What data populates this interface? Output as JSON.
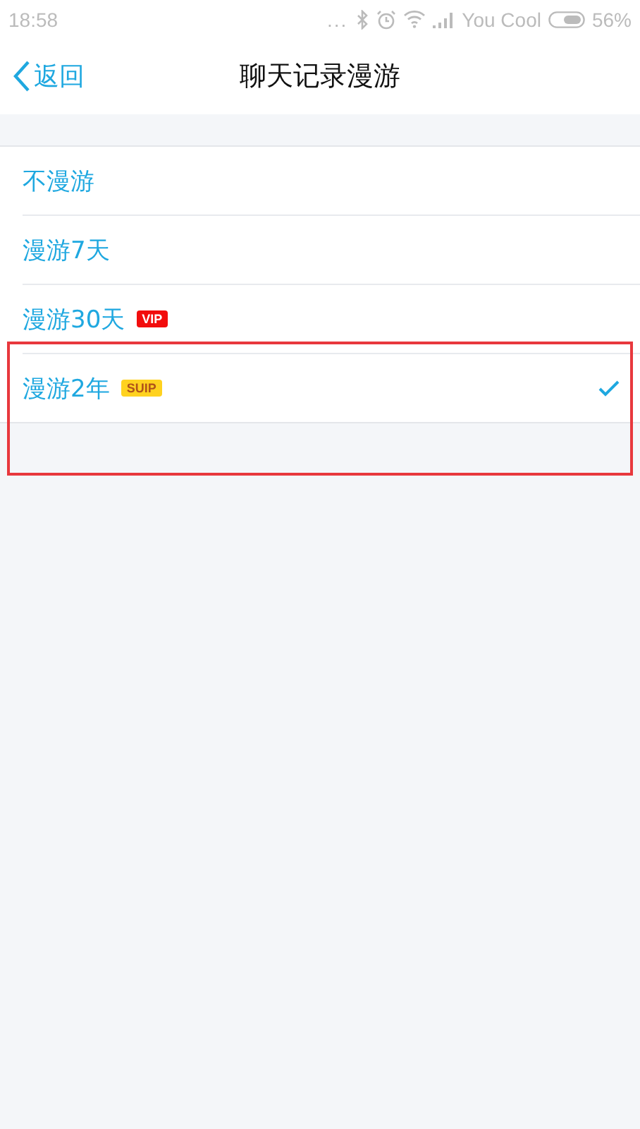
{
  "status_bar": {
    "time": "18:58",
    "dots": "...",
    "carrier": "You Cool",
    "battery": "56%"
  },
  "nav": {
    "back": "返回",
    "title": "聊天记录漫游"
  },
  "options": [
    {
      "label": "不漫游",
      "selected": false
    },
    {
      "label": "漫游7天",
      "selected": false
    },
    {
      "label": "漫游30天",
      "selected": false,
      "badge": {
        "text": "VIP",
        "color": "#f20d0d"
      }
    },
    {
      "label": "漫游2年",
      "selected": true,
      "badge": {
        "text": "SUIP",
        "color": "#ffd21f"
      }
    }
  ],
  "annotation": {
    "kind": "highlight-box",
    "color": "#e8383d"
  }
}
